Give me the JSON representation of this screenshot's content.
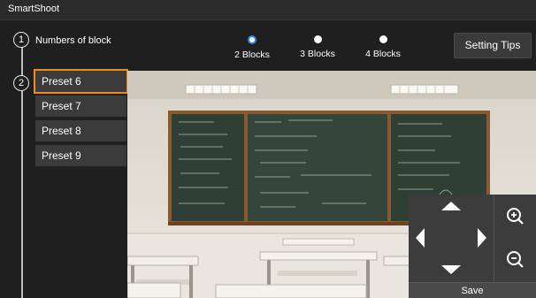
{
  "app": {
    "title": "SmartShoot"
  },
  "steps": {
    "step1_number": "1",
    "step2_number": "2",
    "blocks_label": "Numbers of block"
  },
  "block_options": [
    {
      "label": "2 Blocks",
      "selected": true
    },
    {
      "label": "3 Blocks",
      "selected": false
    },
    {
      "label": "4 Blocks",
      "selected": false
    }
  ],
  "setting_tips_label": "Setting Tips",
  "presets": [
    {
      "label": "Preset 6",
      "selected": true
    },
    {
      "label": "Preset 7",
      "selected": false
    },
    {
      "label": "Preset 8",
      "selected": false
    },
    {
      "label": "Preset 9",
      "selected": false
    }
  ],
  "control_panel": {
    "save_label": "Save",
    "icons": [
      "arrow-up-icon",
      "arrow-left-icon",
      "arrow-right-icon",
      "arrow-down-icon",
      "zoom-in-icon",
      "zoom-out-icon"
    ]
  },
  "colors": {
    "accent": "#f08c1e",
    "radio_selected": "#2f86e6",
    "background": "#1f1f1f",
    "button": "#3b3b3b"
  }
}
